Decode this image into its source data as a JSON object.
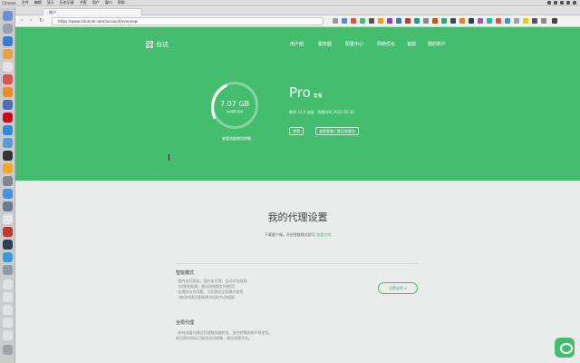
{
  "menubar": {
    "items": [
      "Chrome",
      "文件",
      "编辑",
      "显示",
      "历史记录",
      "书签",
      "用户",
      "窗口",
      "帮助"
    ]
  },
  "browser": {
    "tab_title": "账户",
    "url": "https://www.iatunnel.com/account/overview",
    "back_icon": "back-arrow-icon",
    "forward_icon": "forward-arrow-icon",
    "reload_icon": "reload-icon"
  },
  "site": {
    "logo_text": "台达",
    "nav": [
      "用户组",
      "服务器",
      "配置中心",
      "网络优化",
      "客服",
      "我的账户"
    ]
  },
  "usage": {
    "value": "7.07 GB",
    "sub": "本周期已使用",
    "caption": "查看流量使用明细",
    "fraction_used": 0.25
  },
  "plan": {
    "name": "Pro",
    "badge": "套餐",
    "meta": "剩余 23.0 流量 · 到期时间 2022-04-30",
    "buttons": [
      "续费",
      "变更套餐 / 购买流量包"
    ]
  },
  "content": {
    "title": "我的代理设置",
    "subtitle": "下载客户端，开启智能模式即可",
    "subtitle_link": "查看文档",
    "items": [
      {
        "title": "智能模式",
        "text": "· 国内访问直连，国外走代理，自动识别规则\n（仅限电脑端，建议网络稳定时使用）\n· 若遇到访问问题，可切换到全局模式使用\n（使用时请注意选择合适的节点线路）"
      },
      {
        "title": "全局代理",
        "text": "· 所有流量均通过代理服务器转发，适合特殊网络环境使用，\n部分国内网站可能会访问较慢，建议按需开启。"
      }
    ],
    "pill_label": "设置说明 ∨"
  },
  "colors": {
    "brand": "#45bd6f",
    "background": "#e9ecea"
  }
}
